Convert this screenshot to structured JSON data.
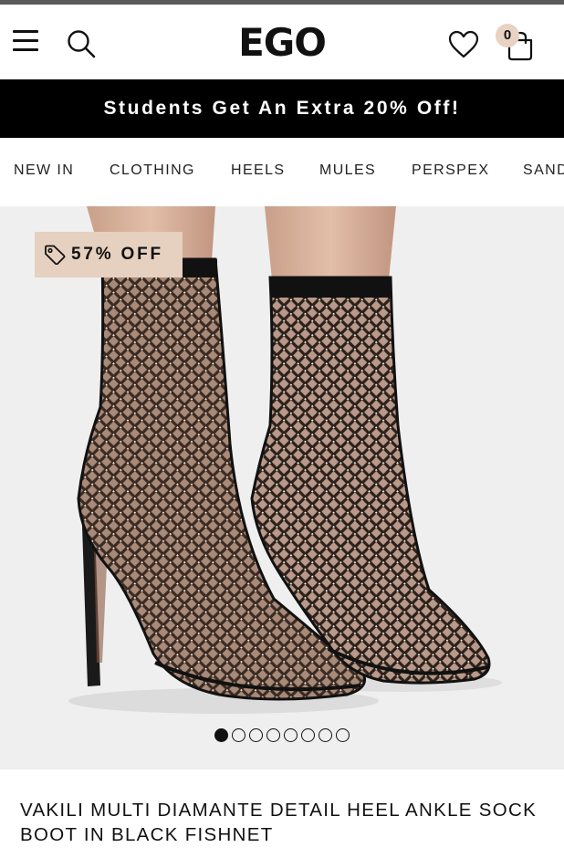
{
  "header": {
    "logo": "EGO",
    "bag_count": "0",
    "icons": [
      "hamburger-menu-icon",
      "search-icon",
      "heart-icon",
      "shopping-bag-icon"
    ]
  },
  "promo": {
    "text": "Students Get An Extra 20% Off!"
  },
  "nav": {
    "items": [
      {
        "label": "NEW IN"
      },
      {
        "label": "CLOTHING"
      },
      {
        "label": "HEELS"
      },
      {
        "label": "MULES"
      },
      {
        "label": "PERSPEX"
      },
      {
        "label": "SAND"
      }
    ]
  },
  "product": {
    "discount_label": "57% OFF",
    "image_count": 8,
    "active_image_index": 0,
    "title": "VAKILI MULTI DIAMANTE DETAIL HEEL ANKLE SOCK BOOT IN BLACK FISHNET"
  },
  "colors": {
    "promo_bg": "#000000",
    "discount_badge": "#e6d0bf",
    "bag_badge": "#e8d2c2",
    "gallery_bg": "#efefef"
  }
}
